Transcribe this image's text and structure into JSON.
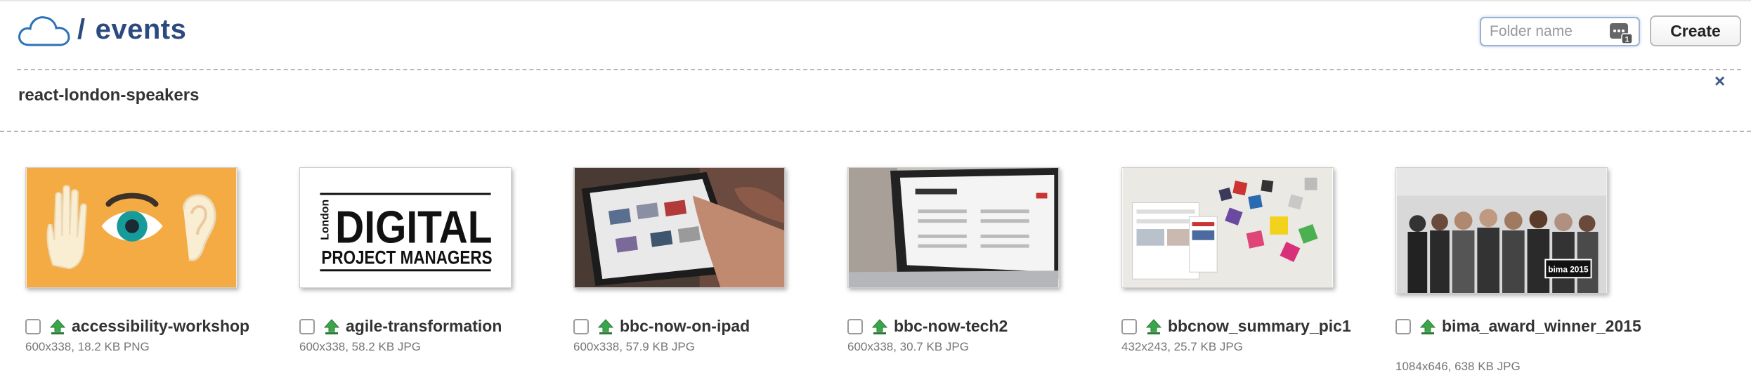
{
  "header": {
    "breadcrumb_separator": "/",
    "folder": "events",
    "folder_name_placeholder": "Folder name",
    "create_label": "Create"
  },
  "subfolder": {
    "name": "react-london-speakers",
    "close_label": "×"
  },
  "thumb_text": {
    "london": "London",
    "digital": "DIGITAL",
    "pm": "PROJECT MANAGERS",
    "bima": "bima 2015"
  },
  "files": [
    {
      "name": "accessibility-workshop",
      "meta": "600x338, 18.2 KB PNG"
    },
    {
      "name": "agile-transformation",
      "meta": "600x338, 58.2 KB JPG"
    },
    {
      "name": "bbc-now-on-ipad",
      "meta": "600x338, 57.9 KB JPG"
    },
    {
      "name": "bbc-now-tech2",
      "meta": "600x338, 30.7 KB JPG"
    },
    {
      "name": "bbcnow_summary_pic1",
      "meta": "432x243, 25.7 KB JPG"
    },
    {
      "name": "bima_award_winner_2015",
      "meta": "1084x646, 638 KB JPG"
    }
  ],
  "colors": {
    "brand": "#2b4a7e",
    "upload_green": "#3aa64a",
    "accessibility_bg": "#f5ab44"
  },
  "icons": [
    "cloud-icon",
    "keyboard-badge-icon",
    "close-icon",
    "checkbox",
    "upload-icon"
  ]
}
